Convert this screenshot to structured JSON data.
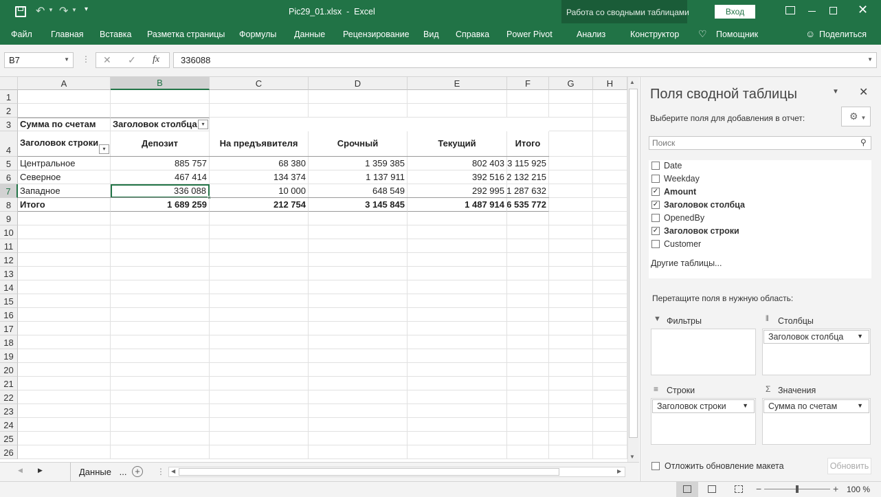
{
  "window": {
    "title": "Pic29_01.xlsx  -  Excel",
    "context_tools": "Работа со сводными таблицами",
    "signin": "Вход"
  },
  "ribbon_tabs": [
    "Файл",
    "Главная",
    "Вставка",
    "Разметка страницы",
    "Формулы",
    "Данные",
    "Рецензирование",
    "Вид",
    "Справка",
    "Power Pivot",
    "Анализ",
    "Конструктор"
  ],
  "helper": "Помощник",
  "share": "Поделиться",
  "formula_bar": {
    "name_box": "B7",
    "fx": "fx",
    "value": "336088"
  },
  "columns": [
    "A",
    "B",
    "C",
    "D",
    "E",
    "F",
    "G",
    "H"
  ],
  "rows": [
    "1",
    "2",
    "3",
    "4",
    "5",
    "6",
    "7",
    "8",
    "9",
    "10",
    "11",
    "12",
    "13",
    "14",
    "15",
    "16",
    "17",
    "18",
    "19",
    "20",
    "21",
    "22",
    "23",
    "24",
    "25",
    "26"
  ],
  "pivot": {
    "r3": {
      "a": "Сумма по счетам",
      "b": "Заголовок столбца"
    },
    "r4": {
      "a": "Заголовок строки",
      "b": "Депозит",
      "c": "На предъявителя",
      "d": "Срочный",
      "e": "Текущий",
      "f": "Итого"
    },
    "r5": {
      "a": "Центральное",
      "b": "885 757",
      "c": "68 380",
      "d": "1 359 385",
      "e": "802 403",
      "f": "3 115 925"
    },
    "r6": {
      "a": "Северное",
      "b": "467 414",
      "c": "134 374",
      "d": "1 137 911",
      "e": "392 516",
      "f": "2 132 215"
    },
    "r7": {
      "a": "Западное",
      "b": "336 088",
      "c": "10 000",
      "d": "648 549",
      "e": "292 995",
      "f": "1 287 632"
    },
    "r8": {
      "a": "Итого",
      "b": "1 689 259",
      "c": "212 754",
      "d": "3 145 845",
      "e": "1 487 914",
      "f": "6 535 772"
    }
  },
  "sheet_tab": "Данные",
  "sheet_more": "...",
  "field_pane": {
    "title": "Поля сводной таблицы",
    "subtitle": "Выберите поля для добавления в отчет:",
    "search_placeholder": "Поиск",
    "fields": [
      {
        "name": "Date",
        "checked": false
      },
      {
        "name": "Weekday",
        "checked": false
      },
      {
        "name": "Amount",
        "checked": true
      },
      {
        "name": "Заголовок столбца",
        "checked": true
      },
      {
        "name": "OpenedBy",
        "checked": false
      },
      {
        "name": "Заголовок строки",
        "checked": true
      },
      {
        "name": "Customer",
        "checked": false
      }
    ],
    "more_tables": "Другие таблицы...",
    "drag_hint": "Перетащите поля в нужную область:",
    "filters": "Фильтры",
    "columns": "Столбцы",
    "rows": "Строки",
    "values": "Значения",
    "columns_item": "Заголовок столбца",
    "rows_item": "Заголовок строки",
    "values_item": "Сумма по счетам",
    "defer": "Отложить обновление макета",
    "update": "Обновить"
  },
  "status": {
    "zoom": "100 %"
  }
}
